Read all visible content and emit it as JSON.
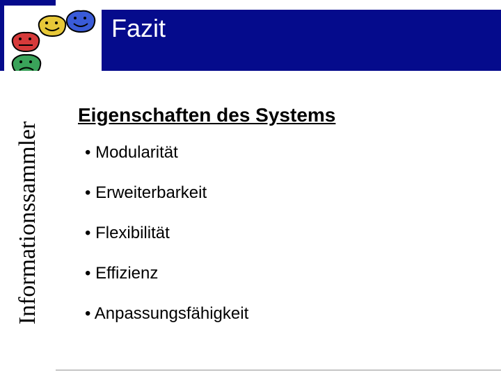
{
  "header": {
    "title": "Fazit"
  },
  "sidebar": {
    "vertical_label": "Informationssammler"
  },
  "faces": {
    "red": {
      "name": "red-flat-face-icon"
    },
    "yellow": {
      "name": "yellow-happy-face-icon"
    },
    "green": {
      "name": "green-sad-face-icon"
    },
    "blue": {
      "name": "blue-happy-face-icon"
    }
  },
  "content": {
    "subtitle": "Eigenschaften des Systems",
    "bullets": [
      "Modularität",
      "Erweiterbarkeit",
      "Flexibilität",
      "Effizienz",
      "Anpassungsfähigkeit"
    ]
  }
}
